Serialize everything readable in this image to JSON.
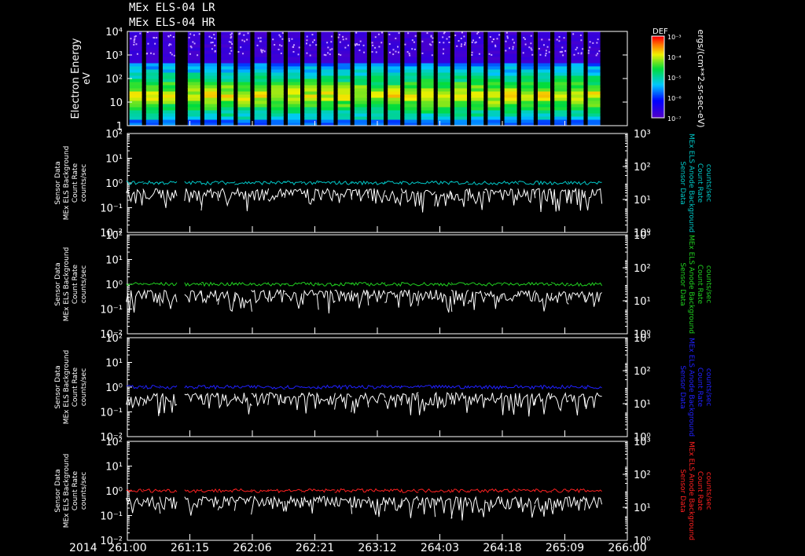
{
  "titles": [
    "MEx ELS-04 LR",
    "MEx ELS-04 HR"
  ],
  "year": "2014",
  "time_ticks": [
    "261:00",
    "261:15",
    "262:06",
    "262:21",
    "263:12",
    "264:03",
    "264:18",
    "265:09",
    "266:00"
  ],
  "colorbar": {
    "label": "DEF",
    "units": "ergs/(cm**2-sr-sec-eV)",
    "ticks": [
      "10⁻³",
      "10⁻⁴",
      "10⁻⁵",
      "10⁻⁶",
      "10⁻⁷"
    ]
  },
  "chart_data": [
    {
      "type": "heatmap",
      "ylabel": "Electron Energy",
      "yunits": "eV",
      "yscale": "log",
      "ylim": [
        1,
        10000
      ],
      "yticks": [
        "10⁴",
        "10³",
        "10²",
        "10",
        "1"
      ],
      "zlim": [
        1e-07,
        0.001
      ],
      "data_intervals": [
        "261:02",
        "261:06",
        "261:10",
        "261:16",
        "261:20",
        "261:24",
        "262:04",
        "262:08",
        "262:12",
        "262:16",
        "262:20",
        "262:24",
        "263:04",
        "263:08",
        "263:12",
        "263:16",
        "263:20",
        "263:24",
        "264:04",
        "264:08",
        "264:12",
        "264:16",
        "264:20",
        "264:24",
        "265:04",
        "265:08",
        "265:12",
        "265:16"
      ]
    },
    {
      "type": "line",
      "ylabel": [
        "Sensor Data",
        "MEx ELS Background",
        "Count Rate",
        "counts/sec"
      ],
      "y2label": [
        "Sensor Data",
        "MEx ELS Anode Background",
        "Count Rate",
        "counts/sec"
      ],
      "yscale": "log",
      "ylim": [
        0.01,
        100
      ],
      "y2lim": [
        0.1,
        1000
      ],
      "yticks": [
        "10²",
        "10¹",
        "10⁰",
        "10⁻¹",
        "10⁻²"
      ],
      "y2ticks": [
        "10³",
        "10²",
        "10¹",
        "10⁰"
      ],
      "series": [
        {
          "color": "#00c8c8",
          "level": 1.0
        },
        {
          "color": "#ffffff",
          "level": 0.6
        }
      ]
    },
    {
      "type": "line",
      "ylabel": [
        "Sensor Data",
        "MEx ELS Background",
        "Count Rate",
        "counts/sec"
      ],
      "y2label": [
        "Sensor Data",
        "MEx ELS Anode Background",
        "Count Rate",
        "counts/sec"
      ],
      "yscale": "log",
      "ylim": [
        0.01,
        100
      ],
      "y2lim": [
        0.1,
        1000
      ],
      "yticks": [
        "10²",
        "10¹",
        "10⁰",
        "10⁻¹",
        "10⁻²"
      ],
      "y2ticks": [
        "10³",
        "10²",
        "10¹",
        "10⁰"
      ],
      "series": [
        {
          "color": "#20d020",
          "level": 1.0
        },
        {
          "color": "#ffffff",
          "level": 0.6
        }
      ]
    },
    {
      "type": "line",
      "ylabel": [
        "Sensor Data",
        "MEx ELS Background",
        "Count Rate",
        "counts/sec"
      ],
      "y2label": [
        "Sensor Data",
        "MEx ELS Anode Background",
        "Count Rate",
        "counts/sec"
      ],
      "yscale": "log",
      "ylim": [
        0.01,
        100
      ],
      "y2lim": [
        0.1,
        1000
      ],
      "yticks": [
        "10²",
        "10¹",
        "10⁰",
        "10⁻¹",
        "10⁻²"
      ],
      "y2ticks": [
        "10³",
        "10²",
        "10¹",
        "10⁰"
      ],
      "series": [
        {
          "color": "#2020ff",
          "level": 1.0
        },
        {
          "color": "#ffffff",
          "level": 0.6
        }
      ]
    },
    {
      "type": "line",
      "ylabel": [
        "Sensor Data",
        "MEx ELS Background",
        "Count Rate",
        "counts/sec"
      ],
      "y2label": [
        "Sensor Data",
        "MEx ELS Anode Background",
        "Count Rate",
        "counts/sec"
      ],
      "yscale": "log",
      "ylim": [
        0.01,
        100
      ],
      "y2lim": [
        0.1,
        1000
      ],
      "yticks": [
        "10²",
        "10¹",
        "10⁰",
        "10⁻¹",
        "10⁻²"
      ],
      "y2ticks": [
        "10³",
        "10²",
        "10¹",
        "10⁰"
      ],
      "series": [
        {
          "color": "#ff2020",
          "level": 1.0
        },
        {
          "color": "#ffffff",
          "level": 0.6
        }
      ]
    }
  ]
}
